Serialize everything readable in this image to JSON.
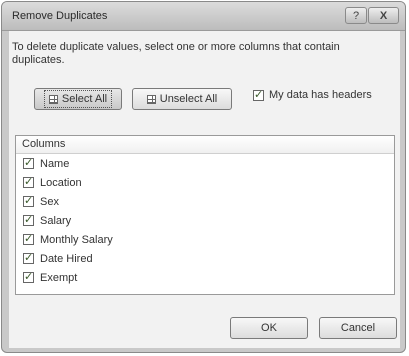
{
  "window": {
    "title": "Remove Duplicates",
    "help_label": "?",
    "close_label": "X"
  },
  "instruction": "To delete duplicate values, select one or more columns that contain duplicates.",
  "buttons": {
    "select_all": "Select All",
    "unselect_all": "Unselect All",
    "ok": "OK",
    "cancel": "Cancel"
  },
  "my_data_has_headers": {
    "label": "My data has headers",
    "checked": true
  },
  "columns": {
    "header": "Columns",
    "items": [
      {
        "label": "Name",
        "checked": true
      },
      {
        "label": "Location",
        "checked": true
      },
      {
        "label": "Sex",
        "checked": true
      },
      {
        "label": "Salary",
        "checked": true
      },
      {
        "label": "Monthly Salary",
        "checked": true
      },
      {
        "label": "Date Hired",
        "checked": true
      },
      {
        "label": "Exempt",
        "checked": true
      }
    ]
  }
}
